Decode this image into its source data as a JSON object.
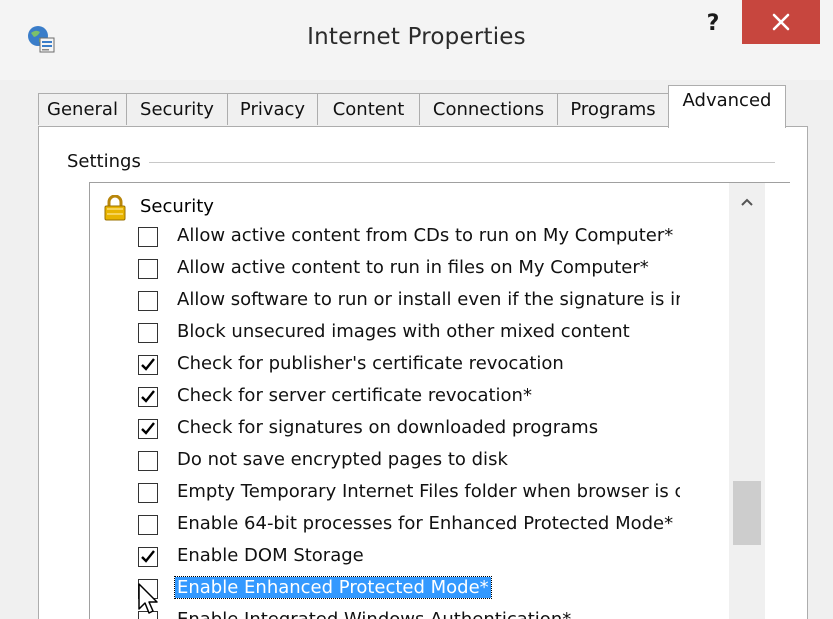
{
  "window": {
    "title": "Internet Properties",
    "help_label": "?"
  },
  "tabs": [
    {
      "label": "General",
      "active": false
    },
    {
      "label": "Security",
      "active": false
    },
    {
      "label": "Privacy",
      "active": false
    },
    {
      "label": "Content",
      "active": false
    },
    {
      "label": "Connections",
      "active": false
    },
    {
      "label": "Programs",
      "active": false
    },
    {
      "label": "Advanced",
      "active": true
    }
  ],
  "settings": {
    "group_label": "Settings",
    "category": {
      "label": "Security",
      "icon": "lock-icon"
    },
    "items": [
      {
        "label": "Allow active content from CDs to run on My Computer*",
        "checked": false
      },
      {
        "label": "Allow active content to run in files on My Computer*",
        "checked": false
      },
      {
        "label": "Allow software to run or install even if the signature is invalid",
        "checked": false
      },
      {
        "label": "Block unsecured images with other mixed content",
        "checked": false
      },
      {
        "label": "Check for publisher's certificate revocation",
        "checked": true
      },
      {
        "label": "Check for server certificate revocation*",
        "checked": true
      },
      {
        "label": "Check for signatures on downloaded programs",
        "checked": true
      },
      {
        "label": "Do not save encrypted pages to disk",
        "checked": false
      },
      {
        "label": "Empty Temporary Internet Files folder when browser is closed",
        "checked": false
      },
      {
        "label": "Enable 64-bit processes for Enhanced Protected Mode*",
        "checked": false
      },
      {
        "label": "Enable DOM Storage",
        "checked": true
      },
      {
        "label": "Enable Enhanced Protected Mode*",
        "checked": false,
        "selected": true
      },
      {
        "label": "Enable Integrated Windows Authentication*",
        "checked": false
      }
    ]
  },
  "colors": {
    "close_button": "#c7463e",
    "selection": "#3399ff"
  }
}
